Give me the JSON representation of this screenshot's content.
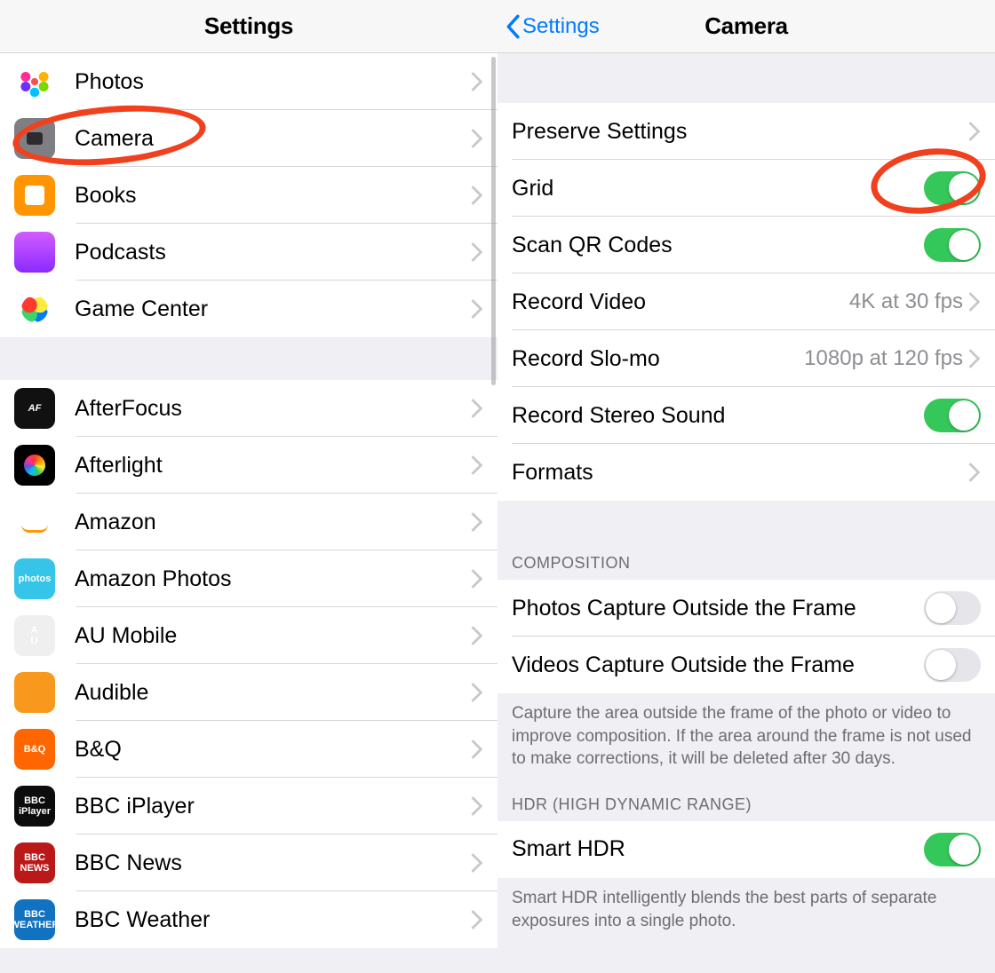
{
  "left": {
    "title": "Settings",
    "group1": [
      {
        "label": "Photos",
        "icon": "photos-icon"
      },
      {
        "label": "Camera",
        "icon": "camera-icon"
      },
      {
        "label": "Books",
        "icon": "books-icon"
      },
      {
        "label": "Podcasts",
        "icon": "podcasts-icon"
      },
      {
        "label": "Game Center",
        "icon": "gamecenter-icon"
      }
    ],
    "group2": [
      {
        "label": "AfterFocus",
        "iconText": "AF",
        "icon": "afterfocus-icon"
      },
      {
        "label": "Afterlight",
        "icon": "afterlight-icon"
      },
      {
        "label": "Amazon",
        "iconText": "amazon",
        "icon": "amazon-icon"
      },
      {
        "label": "Amazon Photos",
        "iconText": "photos",
        "icon": "amazonphotos-icon"
      },
      {
        "label": "AU Mobile",
        "iconText": "A\nU",
        "icon": "aumobile-icon"
      },
      {
        "label": "Audible",
        "icon": "audible-icon"
      },
      {
        "label": "B&Q",
        "iconText": "B&Q",
        "icon": "bandq-icon"
      },
      {
        "label": "BBC iPlayer",
        "iconText": "BBC\niPlayer",
        "icon": "bbciplayer-icon"
      },
      {
        "label": "BBC News",
        "iconText": "BBC\nNEWS",
        "icon": "bbcnews-icon"
      },
      {
        "label": "BBC Weather",
        "iconText": "BBC\nWEATHER",
        "icon": "bbcweather-icon"
      }
    ]
  },
  "right": {
    "back": "Settings",
    "title": "Camera",
    "rows": {
      "preserve": "Preserve Settings",
      "grid": "Grid",
      "scanQR": "Scan QR Codes",
      "recordVideo": {
        "label": "Record Video",
        "value": "4K at 30 fps"
      },
      "recordSlomo": {
        "label": "Record Slo-mo",
        "value": "1080p at 120 fps"
      },
      "stereo": "Record Stereo Sound",
      "formats": "Formats"
    },
    "composition": {
      "header": "COMPOSITION",
      "photosOutside": "Photos Capture Outside the Frame",
      "videosOutside": "Videos Capture Outside the Frame",
      "footer": "Capture the area outside the frame of the photo or video to improve composition. If the area around the frame is not used to make corrections, it will be deleted after 30 days."
    },
    "hdr": {
      "header": "HDR (HIGH DYNAMIC RANGE)",
      "smartHDR": "Smart HDR",
      "footer": "Smart HDR intelligently blends the best parts of separate exposures into a single photo."
    },
    "toggles": {
      "grid": true,
      "scanQR": true,
      "stereo": true,
      "photosOutside": false,
      "videosOutside": false,
      "smartHDR": true
    }
  }
}
